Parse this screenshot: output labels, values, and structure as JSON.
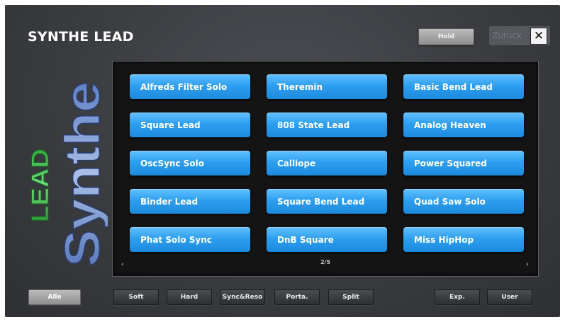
{
  "header": {
    "title": "SYNTHE LEAD",
    "hold_label": "Hold",
    "back_label": "Zurück",
    "close_glyph": "✕"
  },
  "logo": {
    "word_top": "LEAD",
    "word_main": "Synthe",
    "lead_color": "#3ec84a",
    "synthe_color": "#8ea6d6"
  },
  "presets": [
    "Alfreds Filter Solo",
    "Theremin",
    "Basic Bend Lead",
    "Square Lead",
    "808 State Lead",
    "Analog Heaven",
    "OscSync Solo",
    "Calliope",
    "Power Squared",
    "Binder Lead",
    "Square Bend Lead",
    "Quad Saw Solo",
    "Phat Solo Sync",
    "DnB Square",
    "Miss HipHop"
  ],
  "pager": {
    "prev": "‹",
    "next": "›",
    "page": "2/5"
  },
  "categories": {
    "all": "Alle",
    "soft": "Soft",
    "hard": "Hard",
    "sync_reso": "Sync&Reso",
    "porta": "Porta.",
    "split": "Split",
    "exp": "Exp.",
    "user": "User"
  },
  "colors": {
    "preset_blue": "#2e9ff0",
    "background": "#3a3c40",
    "panel": "#141414"
  }
}
